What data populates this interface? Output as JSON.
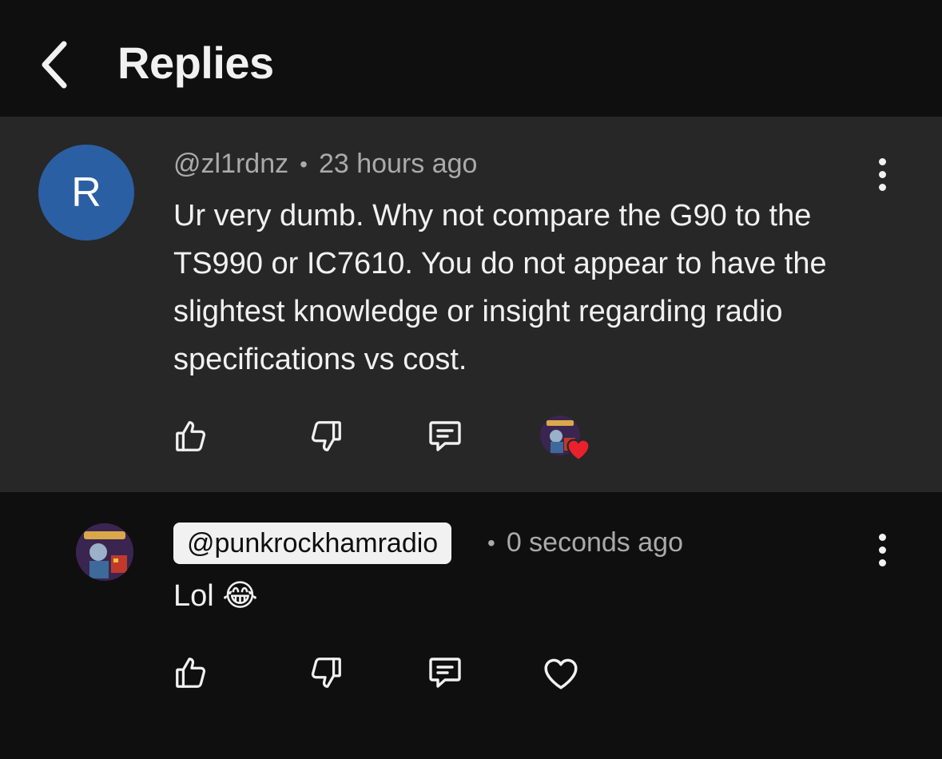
{
  "header": {
    "title": "Replies"
  },
  "parent_comment": {
    "avatar_letter": "R",
    "handle": "@zl1rdnz",
    "separator": "•",
    "time": "23 hours ago",
    "text": "Ur very dumb.  Why not compare the G90 to the TS990 or IC7610. You do not appear to have the slightest knowledge or insight regarding radio specifications vs cost.",
    "creator_hearted": true
  },
  "reply": {
    "handle": "@punkrockhamradio",
    "separator": "•",
    "time": "0 seconds ago",
    "text": "Lol 😂"
  },
  "colors": {
    "background": "#0f0f0f",
    "parent_background": "#272727",
    "avatar_blue": "#2b5fa3",
    "heart_red": "#e8212c",
    "secondary_text": "#aaaaaa"
  },
  "icons": [
    "chevron-left-icon",
    "thumbs-up-icon",
    "thumbs-down-icon",
    "comment-icon",
    "heart-icon",
    "more-vertical-icon"
  ]
}
